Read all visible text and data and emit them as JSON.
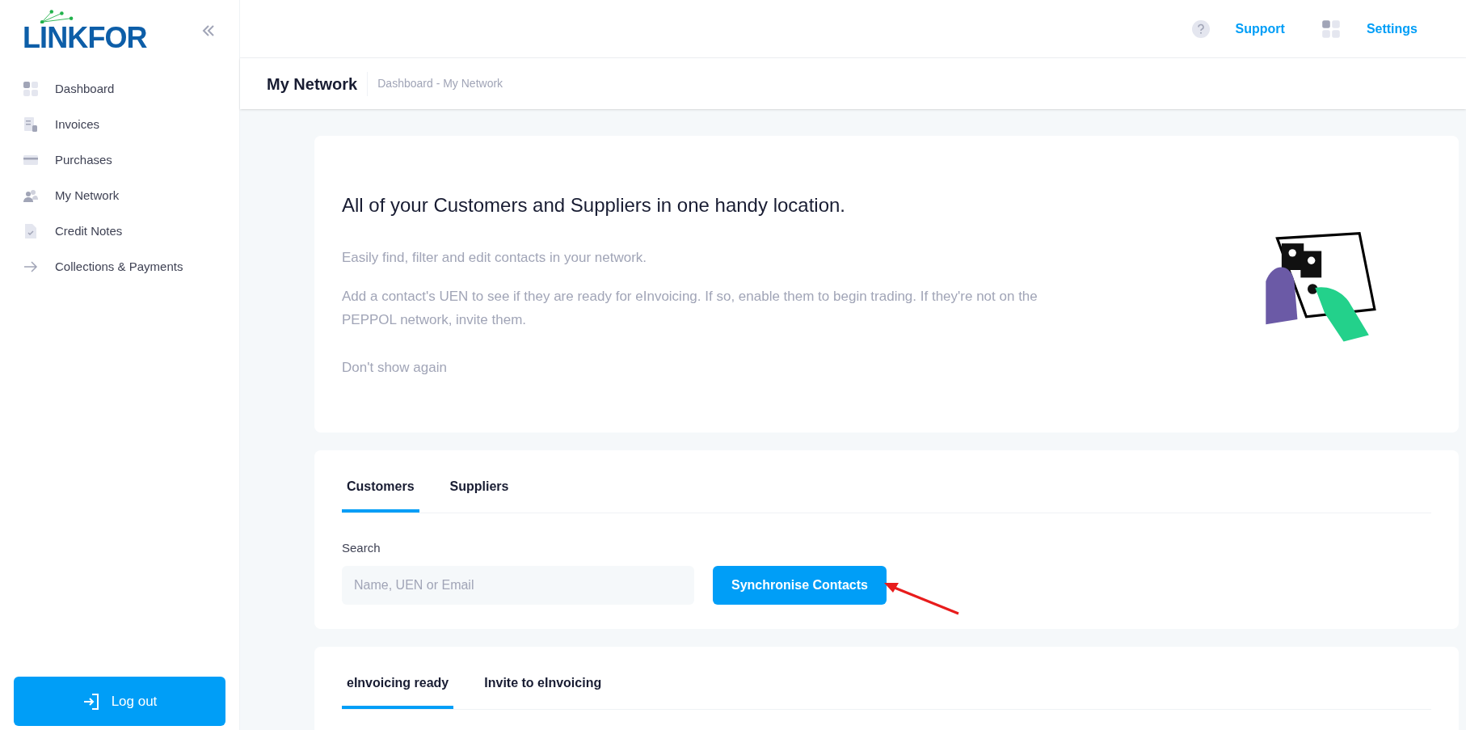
{
  "logo": {
    "text": "LINKFOR"
  },
  "sidebar": {
    "items": [
      {
        "kind": "grid",
        "label": "Dashboard"
      },
      {
        "kind": "invoice",
        "label": "Invoices"
      },
      {
        "kind": "card",
        "label": "Purchases"
      },
      {
        "kind": "people",
        "label": "My Network"
      },
      {
        "kind": "note",
        "label": "Credit Notes"
      },
      {
        "kind": "arrow",
        "label": "Collections & Payments"
      }
    ],
    "logout": "Log out"
  },
  "topbar": {
    "links": [
      {
        "kind": "help",
        "label": "Support"
      },
      {
        "kind": "grid",
        "label": "Settings"
      }
    ]
  },
  "header": {
    "title": "My Network",
    "breadcrumb": "Dashboard - My Network"
  },
  "intro": {
    "heading": "All of your Customers and Suppliers in one handy location.",
    "paragraphs": [
      "Easily find, filter and edit contacts in your network.",
      "Add a contact's UEN to see if they are ready for eInvoicing. If so, enable them to begin trading. If they're not on the PEPPOL network, invite them."
    ],
    "dismiss": "Don't show again"
  },
  "contacts": {
    "tabs": [
      {
        "label": "Customers",
        "selected": true
      },
      {
        "label": "Suppliers",
        "selected": false
      }
    ],
    "search_label": "Search",
    "search": {
      "placeholder": "Name, UEN or Email"
    },
    "sync_button": "Synchronise Contacts"
  },
  "status": {
    "tabs": [
      {
        "label": "eInvoicing ready",
        "selected": true
      },
      {
        "label": "Invite to eInvoicing",
        "selected": false
      }
    ]
  }
}
